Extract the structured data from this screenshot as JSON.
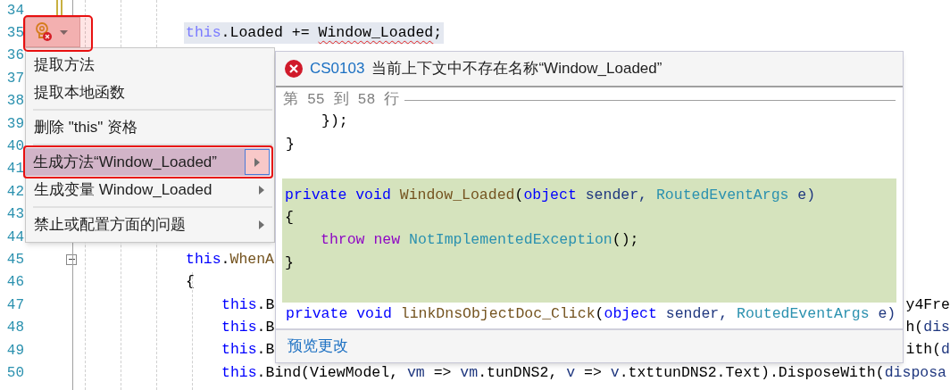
{
  "editor": {
    "lines": [
      {
        "number": "34"
      },
      {
        "number": "35",
        "indented": false,
        "selected": true,
        "left": [
          {
            "text": "this",
            "kind": "this"
          },
          {
            "text": ".Loaded += ",
            "kind": "plain"
          },
          {
            "text": "Window_Loaded",
            "kind": "plain",
            "error": true
          },
          {
            "text": ";",
            "kind": "plain"
          }
        ]
      },
      {
        "number": "36"
      },
      {
        "number": "37"
      },
      {
        "number": "38"
      },
      {
        "number": "39"
      },
      {
        "number": "40"
      },
      {
        "number": "41"
      },
      {
        "number": "42"
      },
      {
        "number": "43"
      },
      {
        "number": "44"
      },
      {
        "number": "45",
        "indented": false,
        "collapsible": true,
        "left": [
          {
            "text": "this",
            "kind": "keyword"
          },
          {
            "text": ".",
            "kind": "plain"
          },
          {
            "text": "WhenA",
            "kind": "method"
          }
        ]
      },
      {
        "number": "46",
        "indented": false,
        "left": [
          {
            "text": "{",
            "kind": "plain"
          }
        ]
      },
      {
        "number": "47",
        "indented": true,
        "left": [
          {
            "text": "this",
            "kind": "keyword"
          },
          {
            "text": ".B",
            "kind": "plain"
          }
        ],
        "right": [
          {
            "text": "y4Fre",
            "kind": "plain"
          }
        ]
      },
      {
        "number": "48",
        "indented": true,
        "left": [
          {
            "text": "this",
            "kind": "keyword"
          },
          {
            "text": ".B",
            "kind": "plain"
          }
        ],
        "right": [
          {
            "text": "h(",
            "kind": "plain"
          },
          {
            "text": "dis",
            "kind": "param"
          }
        ]
      },
      {
        "number": "49",
        "indented": true,
        "left": [
          {
            "text": "this",
            "kind": "keyword"
          },
          {
            "text": ".B",
            "kind": "plain"
          }
        ],
        "right": [
          {
            "text": "ith(",
            "kind": "plain"
          },
          {
            "text": "d",
            "kind": "param"
          }
        ]
      },
      {
        "number": "50",
        "indented": true,
        "left": [
          {
            "text": "this",
            "kind": "keyword"
          },
          {
            "text": ".Bind(ViewModel, ",
            "kind": "plain"
          },
          {
            "text": "vm",
            "kind": "param"
          },
          {
            "text": " => ",
            "kind": "plain"
          },
          {
            "text": "vm",
            "kind": "param"
          },
          {
            "text": ".tunDNS2, ",
            "kind": "plain"
          },
          {
            "text": "v",
            "kind": "param"
          },
          {
            "text": " => ",
            "kind": "plain"
          },
          {
            "text": "v",
            "kind": "param"
          },
          {
            "text": ".txttunDNS2.Text).DisposeWith(",
            "kind": "plain"
          },
          {
            "text": "disposa",
            "kind": "param"
          }
        ]
      }
    ]
  },
  "lightbulb": {
    "marked": true
  },
  "menu": {
    "items": [
      {
        "kind": "item",
        "label": "提取方法",
        "submenu": false,
        "selected": false,
        "marked": false
      },
      {
        "kind": "item",
        "label": "提取本地函数",
        "submenu": false,
        "selected": false,
        "marked": false
      },
      {
        "kind": "separator"
      },
      {
        "kind": "item",
        "label": "删除 \"this\" 资格",
        "submenu": false,
        "selected": false,
        "marked": false
      },
      {
        "kind": "separator"
      },
      {
        "kind": "item",
        "label": "生成方法“Window_Loaded”",
        "submenu": true,
        "selected": true,
        "marked": true
      },
      {
        "kind": "item",
        "label": "生成变量 Window_Loaded",
        "submenu": true,
        "selected": false,
        "marked": false
      },
      {
        "kind": "separator"
      },
      {
        "kind": "item",
        "label": "禁止或配置方面的问题",
        "submenu": true,
        "selected": false,
        "marked": false
      }
    ]
  },
  "preview": {
    "error_code": "CS0103",
    "message": "当前上下文中不存在名称“Window_Loaded”",
    "range": "第 55 到 58 行",
    "lines": [
      {
        "indented": true,
        "added": false,
        "tokens": [
          {
            "text": "});",
            "kind": "plain"
          }
        ]
      },
      {
        "indented": false,
        "added": false,
        "tokens": [
          {
            "text": "}",
            "kind": "plain"
          }
        ]
      },
      {
        "added": false
      },
      {
        "indented": false,
        "added": true,
        "tokens": [
          {
            "text": "private void ",
            "kind": "keyword"
          },
          {
            "text": "Window_Loaded",
            "kind": "method"
          },
          {
            "text": "(",
            "kind": "plain"
          },
          {
            "text": "object",
            "kind": "keyword"
          },
          {
            "text": " sender, ",
            "kind": "param"
          },
          {
            "text": "RoutedEventArgs",
            "kind": "type"
          },
          {
            "text": " e)",
            "kind": "param"
          }
        ]
      },
      {
        "indented": false,
        "added": true,
        "tokens": [
          {
            "text": "{",
            "kind": "plain"
          }
        ]
      },
      {
        "indented": true,
        "added": true,
        "tokens": [
          {
            "text": "throw new ",
            "kind": "control"
          },
          {
            "text": "NotImplementedException",
            "kind": "type"
          },
          {
            "text": "();",
            "kind": "plain"
          }
        ]
      },
      {
        "indented": false,
        "added": true,
        "tokens": [
          {
            "text": "}",
            "kind": "plain"
          }
        ]
      },
      {
        "added": true
      },
      {
        "indented": false,
        "added": false,
        "tokens": [
          {
            "text": "private void ",
            "kind": "keyword"
          },
          {
            "text": "linkDnsObjectDoc_Click",
            "kind": "method"
          },
          {
            "text": "(",
            "kind": "plain"
          },
          {
            "text": "object",
            "kind": "keyword"
          },
          {
            "text": " sender, ",
            "kind": "param"
          },
          {
            "text": "RoutedEventArgs",
            "kind": "type"
          },
          {
            "text": " e)",
            "kind": "param"
          }
        ]
      }
    ],
    "footer_link": "预览更改"
  }
}
